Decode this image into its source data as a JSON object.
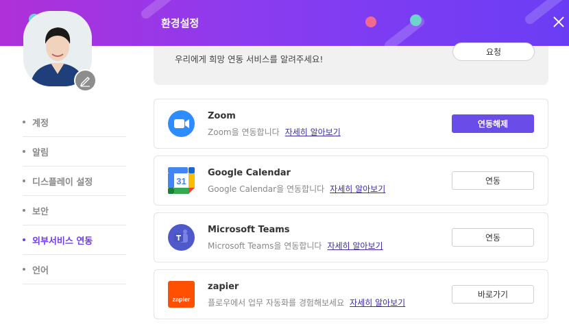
{
  "header": {
    "title": "환경설정",
    "close_icon": "close-icon"
  },
  "profile": {
    "edit_icon": "pencil-icon"
  },
  "sidebar": {
    "items": [
      {
        "label": "계정",
        "active": false
      },
      {
        "label": "알림",
        "active": false
      },
      {
        "label": "디스플레이 설정",
        "active": false
      },
      {
        "label": "보안",
        "active": false
      },
      {
        "label": "외부서비스 연동",
        "active": true
      },
      {
        "label": "언어",
        "active": false
      }
    ]
  },
  "request": {
    "text": "우리에게 희망 연동 서비스를 알려주세요!",
    "button": "요청"
  },
  "integrations": [
    {
      "name": "Zoom",
      "desc": "Zoom을 연동합니다",
      "link": "자세히 알아보기",
      "action": "연동해제",
      "icon": "zoom-icon"
    },
    {
      "name": "Google Calendar",
      "desc": "Google Calendar을 연동합니다",
      "link": "자세히 알아보기",
      "action": "연동",
      "icon": "google-calendar-icon"
    },
    {
      "name": "Microsoft Teams",
      "desc": "Microsoft Teams을 연동합니다",
      "link": "자세히 알아보기",
      "action": "연동",
      "icon": "microsoft-teams-icon"
    },
    {
      "name": "zapier",
      "desc": "플로우에서 업무 자동화를 경험해보세요",
      "link": "자세히 알아보기",
      "action": "바로가기",
      "icon": "zapier-icon",
      "logo_text": "zapier"
    }
  ],
  "colors": {
    "accent": "#6a4de8",
    "header_start": "#b030d8",
    "header_end": "#6a3df5"
  }
}
